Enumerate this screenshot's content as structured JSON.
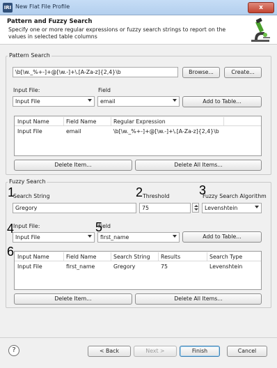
{
  "window": {
    "title": "New Flat File Profile",
    "app_icon_text": "IRI",
    "close_glyph": "x"
  },
  "banner": {
    "heading": "Pattern and Fuzzy Search",
    "description": "Specify one or more regular expressions or fuzzy search strings to report on the values in selected table columns",
    "icon": "microscope-icon"
  },
  "pattern_search": {
    "group_label": "Pattern Search",
    "pattern_value": "\\b[\\w._%+-]+@[\\w.-]+\\.[A-Za-z]{2,4}\\b",
    "browse_label": "Browse...",
    "create_label": "Create...",
    "input_file_label": "Input File:",
    "input_file_value": "Input File",
    "field_label": "Field",
    "field_value": "email",
    "add_label": "Add to Table...",
    "table": {
      "headers": [
        "Input Name",
        "Field Name",
        "Regular Expression"
      ],
      "rows": [
        [
          "Input File",
          "email",
          "\\b[\\w._%+-]+@[\\w.-]+\\.[A-Za-z]{2,4}\\b"
        ]
      ]
    },
    "delete_label": "Delete Item...",
    "delete_all_label": "Delete All Items..."
  },
  "fuzzy_search": {
    "group_label": "Fuzzy Search",
    "search_string_label": "Search String",
    "search_string_value": "Gregory",
    "threshold_label": "Threshold",
    "threshold_value": "75",
    "algorithm_label": "Fuzzy Search Algorithm",
    "algorithm_value": "Levenshtein",
    "input_file_label": "Input File:",
    "input_file_value": "Input File",
    "field_label": "Field",
    "field_value": "first_name",
    "add_label": "Add to Table...",
    "table": {
      "headers": [
        "Input Name",
        "Field Name",
        "Search String",
        "Results",
        "Search Type"
      ],
      "rows": [
        [
          "Input File",
          "first_name",
          "Gregory",
          "75",
          "Levenshtein"
        ]
      ]
    },
    "delete_label": "Delete Item...",
    "delete_all_label": "Delete All Items..."
  },
  "annotations": [
    "1",
    "2",
    "3",
    "4",
    "5",
    "6"
  ],
  "footer": {
    "help_glyph": "?",
    "back_label": "< Back",
    "next_label": "Next >",
    "finish_label": "Finish",
    "cancel_label": "Cancel"
  }
}
